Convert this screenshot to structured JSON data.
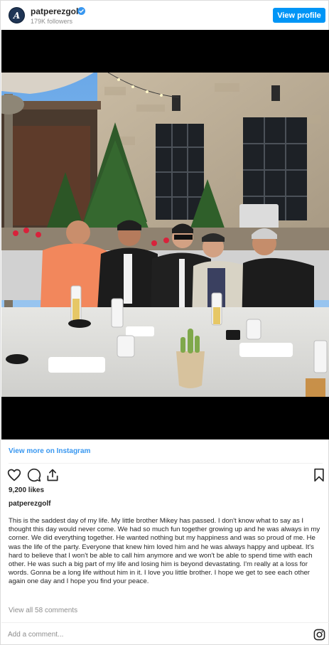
{
  "header": {
    "avatar_icon": "account-logo-icon",
    "avatar_letter": "A",
    "username": "patperezgolf",
    "verified_icon": "verified-badge-icon",
    "followers": "179K followers",
    "view_profile_label": "View profile"
  },
  "media": {
    "description_icon": "group-photo-image"
  },
  "view_more": "View more on Instagram",
  "actions": {
    "like_icon": "heart-icon",
    "comment_icon": "comment-icon",
    "share_icon": "share-icon",
    "save_icon": "bookmark-icon"
  },
  "likes": "9,200 likes",
  "caption_user": "patperezgolf",
  "caption": "This is the saddest day of my life. My little brother Mikey has passed. I don't know what to say as I thought this day would never come. We had so much fun together growing up and he was always in my corner. We did everything together. He wanted nothing but my happiness and was so proud of me. He was the life of the party. Everyone that knew him loved him and he was always happy and upbeat. It's hard to believe that I won't be able to call him anymore and we won't be able to spend time with each other. He was such a big part of my life and losing him is beyond devastating. I'm really at a loss for words. Gonna be a long life without him in it. I love you little brother. I hope we get to see each other again one day and I hope you find your peace.",
  "view_all_comments": "View all 58 comments",
  "comment": {
    "placeholder": "Add a comment...",
    "value": ""
  },
  "colors": {
    "accent": "#0095f6",
    "link": "#3897f0",
    "muted": "#8e8e8e",
    "text": "#262626"
  }
}
